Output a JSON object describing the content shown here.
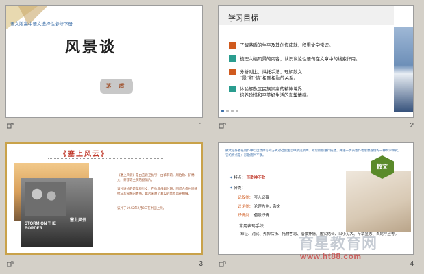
{
  "slides": [
    {
      "number": "1",
      "subtitle": "语文版高中语文选择性必修下册",
      "title": "风景谈",
      "author": "茅  盾"
    },
    {
      "number": "2",
      "heading": "学习目标",
      "items": [
        {
          "text": "了解茅盾的生平及其创作成就，积累文学常识。",
          "color": "#d05a1e"
        },
        {
          "text": "梳理六幅风景的内容，认识议论性语句在文章中的线索作用。",
          "color": "#2a9d8f"
        },
        {
          "text": "分析对比、烘托手法，理解散文",
          "text2": "“景”和“情”相随相融的关系。",
          "color": "#d05a1e"
        },
        {
          "text": "体验解放区民族崇高的精神境界，",
          "text2": "培养珍惜和平美好生活的真挚情感。",
          "color": "#2a9d8f"
        }
      ]
    },
    {
      "number": "3",
      "title": "《塞上风云》",
      "para1": "《塞上风云》是由应云卫执导，由黎莉莉、周伯勋、舒绣文、黎铿等主演的剧情片。",
      "para2": "该片讲述的是草原儿女，在抗日战争时期，团结合作共同抵抗日军侵略的故事，影片采用了真实的草原风光拍摄。",
      "para3": "该片于1942年2月8日在中国上映。",
      "poster_title": "STORM ON THE BORDER",
      "poster_cn": "塞上风云"
    },
    {
      "number": "4",
      "intro": "散文是作者在创作中以自然抒写的方式对社会生活中所见所闻、所思所感进行描述，并进一步表达作者思想感情的一种文学样式。它的特点是：形散而神不散。",
      "badge": "散文",
      "points": [
        {
          "label": "特点：",
          "value": "形散神不散"
        },
        {
          "label": "分类：",
          "value": ""
        },
        {
          "label": "记叙类：",
          "value": "写人记事"
        },
        {
          "label": "议论类：",
          "value": "论理为主，杂文"
        },
        {
          "label": "抒情类：",
          "value": "借景抒情"
        }
      ],
      "methods_heading": "常用表现手法：",
      "methods": "象征、对比、先抑后扬、托物言志、借景抒情、虚实结合、以小见大、卒章显志、首尾呼应等。"
    }
  ],
  "watermark": {
    "cn": "育星教育网",
    "url": "www.ht88.com"
  },
  "colors": {
    "accent_orange": "#d05a1e",
    "accent_teal": "#2a9d8f",
    "badge_green": "#5a8a2a",
    "title_red": "#c0392b"
  }
}
